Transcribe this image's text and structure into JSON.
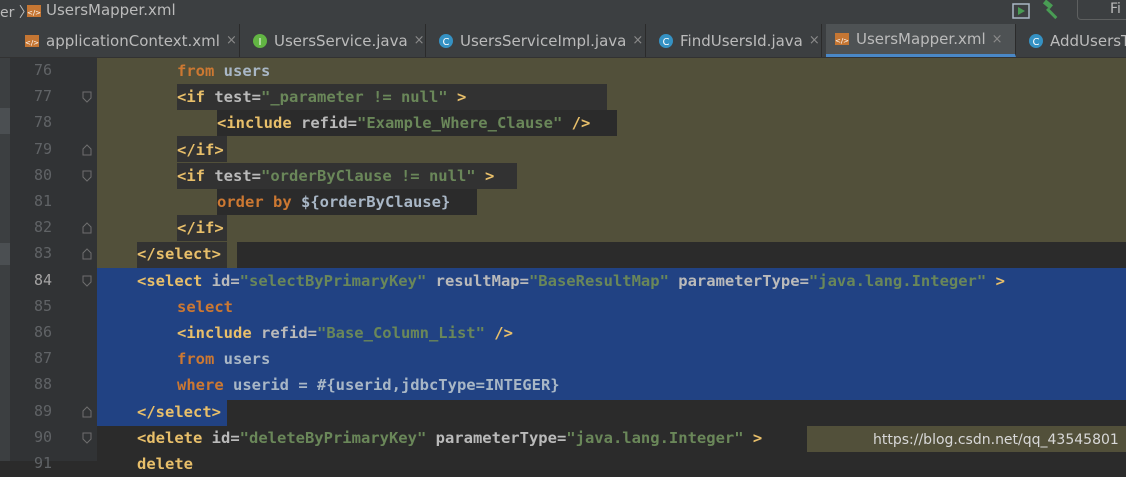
{
  "titlebar": {
    "crumb": "er 〉",
    "file_title": "UsersMapper.xml",
    "find_label": "Fi"
  },
  "tabs": [
    {
      "label": "applicationContext.xml",
      "icon": "xml-file-icon",
      "close": "×"
    },
    {
      "label": "UsersService.java",
      "icon": "interface-icon",
      "close": "×"
    },
    {
      "label": "UsersServiceImpl.java",
      "icon": "class-icon",
      "close": "×"
    },
    {
      "label": "FindUsersId.java",
      "icon": "class-icon",
      "close": "×"
    },
    {
      "label": "UsersMapper.xml",
      "icon": "xml-file-icon",
      "close": "×",
      "active": true
    },
    {
      "label": "AddUsersTe",
      "icon": "class-icon"
    }
  ],
  "lines": [
    {
      "num": "76",
      "tokens": [
        [
          "kw",
          "from"
        ],
        [
          "txt",
          " users"
        ]
      ]
    },
    {
      "num": "77",
      "tokens": [
        [
          "tag",
          "<if"
        ],
        [
          "attr",
          " test="
        ],
        [
          "str",
          "\"_parameter != null\""
        ],
        [
          "tag",
          " >"
        ]
      ]
    },
    {
      "num": "78",
      "tokens": [
        [
          "tag",
          "<include"
        ],
        [
          "attr",
          " refid="
        ],
        [
          "str",
          "\"Example_Where_Clause\""
        ],
        [
          "tag",
          " />"
        ]
      ]
    },
    {
      "num": "79",
      "tokens": [
        [
          "tag",
          "</if>"
        ]
      ]
    },
    {
      "num": "80",
      "tokens": [
        [
          "tag",
          "<if"
        ],
        [
          "attr",
          " test="
        ],
        [
          "str",
          "\"orderByClause != null\""
        ],
        [
          "tag",
          " >"
        ]
      ]
    },
    {
      "num": "81",
      "tokens": [
        [
          "kw",
          "order by"
        ],
        [
          "txt",
          " ${orderByClause}"
        ]
      ]
    },
    {
      "num": "82",
      "tokens": [
        [
          "tag",
          "</if>"
        ]
      ]
    },
    {
      "num": "83",
      "tokens": [
        [
          "tag",
          "</select>"
        ]
      ]
    },
    {
      "num": "84",
      "tokens": [
        [
          "tag",
          "<select"
        ],
        [
          "attr",
          " id="
        ],
        [
          "str",
          "\"selectByPrimaryKey\""
        ],
        [
          "attr",
          " resultMap="
        ],
        [
          "str",
          "\"BaseResultMap\""
        ],
        [
          "attr",
          " parameterType="
        ],
        [
          "str",
          "\"java.lang.Integer\""
        ],
        [
          "tag",
          " >"
        ]
      ]
    },
    {
      "num": "85",
      "tokens": [
        [
          "kw",
          "select"
        ]
      ]
    },
    {
      "num": "86",
      "tokens": [
        [
          "tag",
          "<include"
        ],
        [
          "attr",
          " refid="
        ],
        [
          "str",
          "\"Base_Column_List\""
        ],
        [
          "tag",
          " />"
        ]
      ]
    },
    {
      "num": "87",
      "tokens": [
        [
          "kw",
          "from"
        ],
        [
          "txt",
          " users"
        ]
      ]
    },
    {
      "num": "88",
      "tokens": [
        [
          "kw",
          "where"
        ],
        [
          "txt",
          " userid = #{userid,jdbcType=INTEGER}"
        ]
      ]
    },
    {
      "num": "89",
      "tokens": [
        [
          "tag",
          "</select>"
        ]
      ]
    },
    {
      "num": "90",
      "tokens": [
        [
          "tag",
          "<delete"
        ],
        [
          "attr",
          " id="
        ],
        [
          "str",
          "\"deleteByPrimaryKey\""
        ],
        [
          "attr",
          " parameterType="
        ],
        [
          "str",
          "\"java.lang.Integer\""
        ],
        [
          "tag",
          " >"
        ]
      ]
    },
    {
      "num": "91",
      "tokens": [
        [
          "tag",
          "delete"
        ]
      ]
    }
  ],
  "current_line": "84",
  "watermark": "https://blog.csdn.net/qq_43545801",
  "colors": {
    "background": "#2b2b2b",
    "selection": "#214283",
    "tag_highlight": "#52503a",
    "xml_tag": "#e8bf6a",
    "attr_value": "#6a8759",
    "keyword": "#cc7832",
    "active_tab_underline": "#4a88c7"
  }
}
